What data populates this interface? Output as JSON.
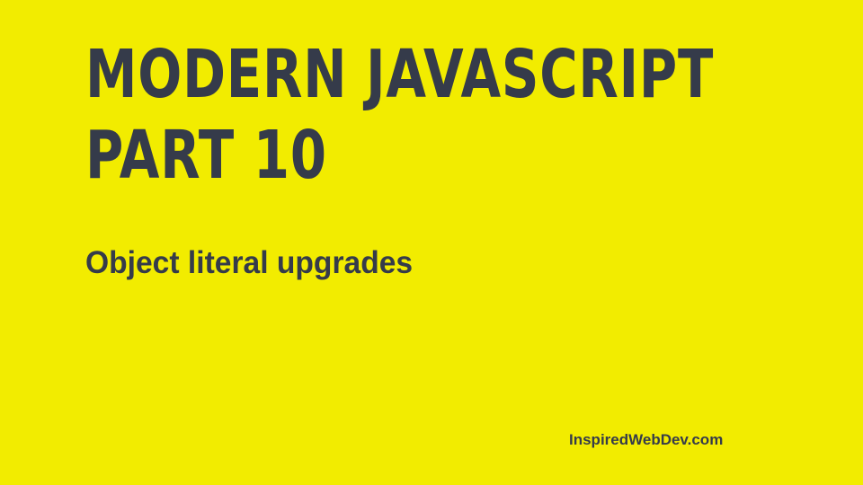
{
  "slide": {
    "title_line1": "MODERN JAVASCRIPT",
    "title_line2": "PART 10",
    "subtitle": "Object literal upgrades",
    "footer": "InspiredWebDev.com",
    "colors": {
      "background": "#f2ec00",
      "text": "#353b4a"
    }
  }
}
